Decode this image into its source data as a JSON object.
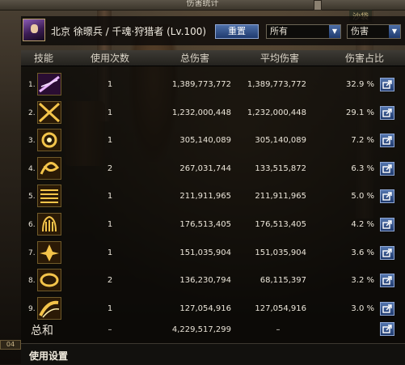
{
  "window": {
    "title": "伤害统计"
  },
  "side_tag": "沙袋",
  "character": {
    "name": "北京 徐暻兵 / 千魂·狩猎者 (Lv.100)"
  },
  "controls": {
    "reset_label": "重置",
    "filter_target": "所有",
    "filter_type": "伤害"
  },
  "columns": {
    "skill": "技能",
    "uses": "使用次数",
    "total": "总伤害",
    "avg": "平均伤害",
    "pct": "伤害占比"
  },
  "rows": [
    {
      "rank": "1.",
      "uses": "1",
      "total": "1,389,773,772",
      "avg": "1,389,773,772",
      "pct": "32.9 %",
      "icon": "purple-slash-skill-icon"
    },
    {
      "rank": "2.",
      "uses": "1",
      "total": "1,232,000,448",
      "avg": "1,232,000,448",
      "pct": "29.1 %",
      "icon": "golden-cross-slash-skill-icon"
    },
    {
      "rank": "3.",
      "uses": "1",
      "total": "305,140,089",
      "avg": "305,140,089",
      "pct": "7.2 %",
      "icon": "golden-spiral-skill-icon"
    },
    {
      "rank": "4.",
      "uses": "2",
      "total": "267,031,744",
      "avg": "133,515,872",
      "pct": "6.3 %",
      "icon": "golden-whirl-skill-icon"
    },
    {
      "rank": "5.",
      "uses": "1",
      "total": "211,911,965",
      "avg": "211,911,965",
      "pct": "5.0 %",
      "icon": "golden-lines-skill-icon"
    },
    {
      "rank": "6.",
      "uses": "1",
      "total": "176,513,405",
      "avg": "176,513,405",
      "pct": "4.2 %",
      "icon": "golden-claw-skill-icon"
    },
    {
      "rank": "7.",
      "uses": "1",
      "total": "151,035,904",
      "avg": "151,035,904",
      "pct": "3.6 %",
      "icon": "golden-burst-skill-icon"
    },
    {
      "rank": "8.",
      "uses": "2",
      "total": "136,230,794",
      "avg": "68,115,397",
      "pct": "3.2 %",
      "icon": "golden-ring-skill-icon"
    },
    {
      "rank": "9.",
      "uses": "1",
      "total": "127,054,916",
      "avg": "127,054,916",
      "pct": "3.0 %",
      "icon": "golden-swipe-skill-icon"
    }
  ],
  "summary": {
    "label": "总和",
    "uses": "–",
    "total": "4,229,517,299",
    "avg": "–"
  },
  "footer": {
    "settings_label": "使用设置"
  },
  "side_badge": "04",
  "colors": {
    "button_blue": "#1f3a6e",
    "gold": "#e0b24a",
    "panel_dark": "#0a0907"
  }
}
